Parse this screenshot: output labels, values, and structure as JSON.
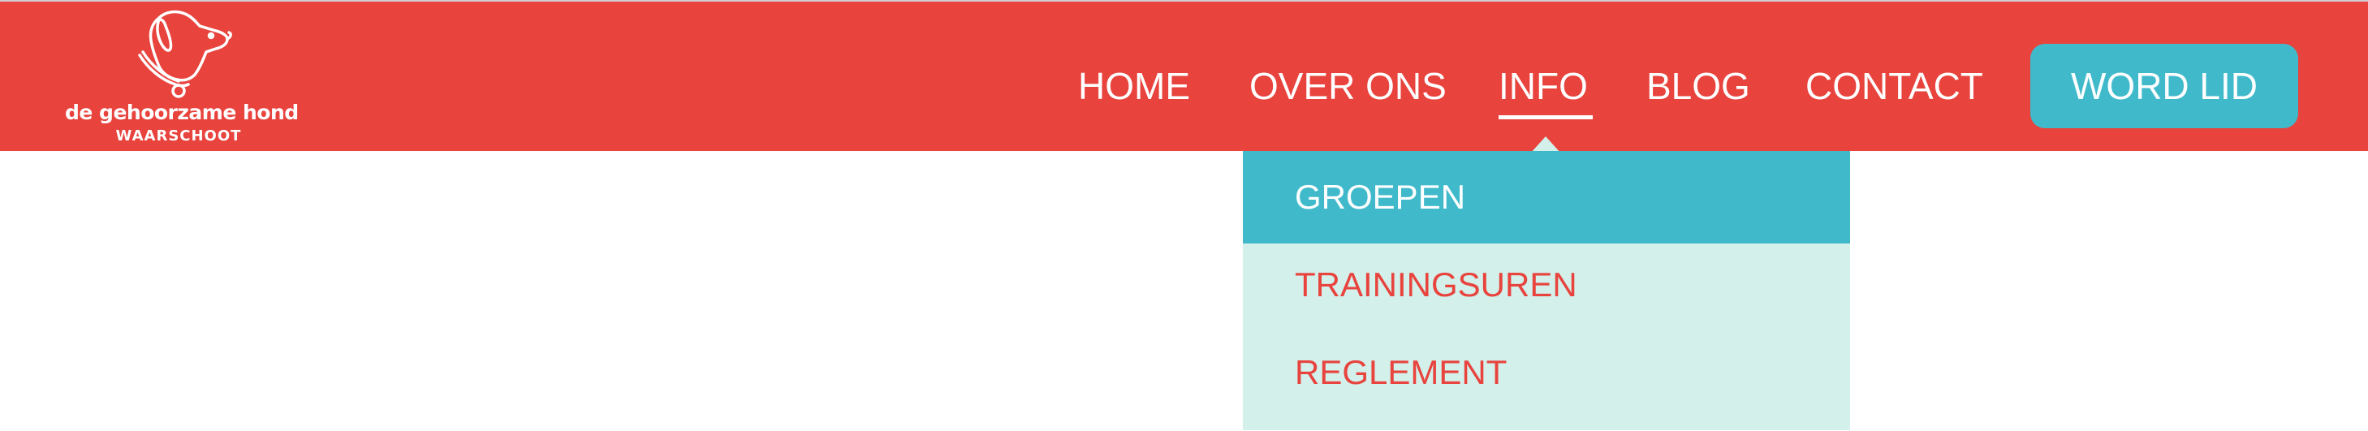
{
  "brand": {
    "name": "de gehoorzame hond",
    "location": "WAARSCHOOT"
  },
  "nav": {
    "items": [
      {
        "label": "HOME",
        "active": false
      },
      {
        "label": "OVER ONS",
        "active": false
      },
      {
        "label": "INFO",
        "active": true
      },
      {
        "label": "BLOG",
        "active": false
      },
      {
        "label": "CONTACT",
        "active": false
      }
    ],
    "cta_label": "WORD LID"
  },
  "dropdown": {
    "items": [
      {
        "label": "GROEPEN",
        "active": true
      },
      {
        "label": "TRAININGSUREN",
        "active": false
      },
      {
        "label": "REGLEMENT",
        "active": false
      }
    ]
  },
  "icons": {
    "logo": "dog-head-icon"
  },
  "colors": {
    "header_bg": "#e8433d",
    "accent": "#40bacb",
    "dropdown_bg": "#d3f0eb",
    "dropdown_text": "#e8433d",
    "nav_text": "#ffffff"
  }
}
